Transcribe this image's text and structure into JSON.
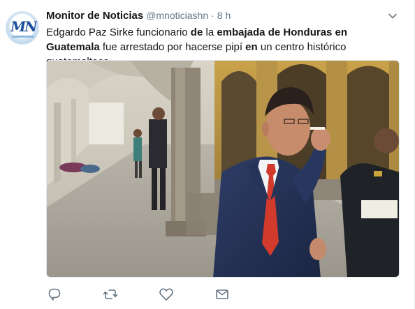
{
  "tweet": {
    "author_name": "Monitor de Noticias",
    "author_handle": "@mnoticiashn",
    "separator": "·",
    "time": "8 h",
    "text_parts": [
      {
        "t": "Edgardo Paz Sirke funcionario ",
        "b": false
      },
      {
        "t": "de",
        "b": true
      },
      {
        "t": " la ",
        "b": false
      },
      {
        "t": "embajada de Honduras en Guatemala",
        "b": true
      },
      {
        "t": " fue arrestado por hacerse pipí ",
        "b": false
      },
      {
        "t": "en",
        "b": true
      },
      {
        "t": " un centro histórico guatemalteco.",
        "b": false
      }
    ]
  },
  "avatar": {
    "logo_text": "MN"
  },
  "icons": {
    "caret": "chevron-down-icon",
    "reply": "reply-icon",
    "retweet": "retweet-icon",
    "like": "heart-icon",
    "dm": "envelope-icon"
  },
  "colors": {
    "icon_gray": "#657786",
    "text": "#14171a",
    "muted": "#657786"
  }
}
